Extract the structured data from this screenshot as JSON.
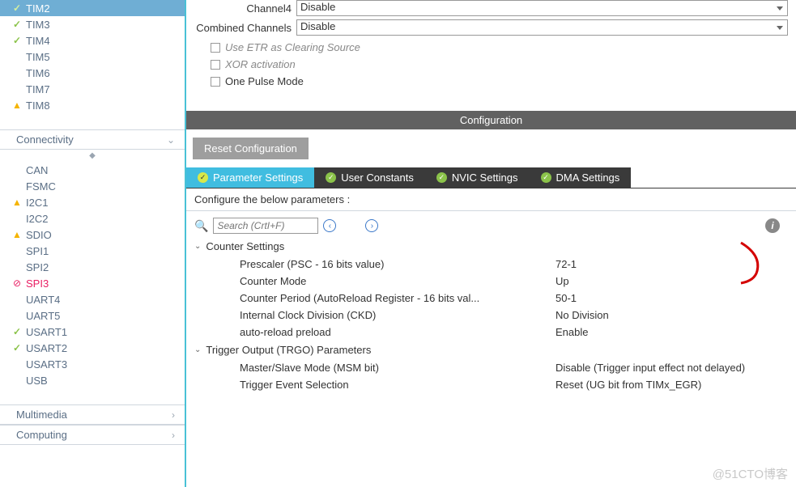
{
  "sidebar": {
    "timers": [
      {
        "label": "TIM2",
        "mark": "check",
        "selected": true
      },
      {
        "label": "TIM3",
        "mark": "check"
      },
      {
        "label": "TIM4",
        "mark": "check"
      },
      {
        "label": "TIM5",
        "mark": ""
      },
      {
        "label": "TIM6",
        "mark": ""
      },
      {
        "label": "TIM7",
        "mark": ""
      },
      {
        "label": "TIM8",
        "mark": "warn"
      }
    ],
    "sections": {
      "connectivity_label": "Connectivity",
      "multimedia_label": "Multimedia",
      "computing_label": "Computing"
    },
    "connectivity": [
      {
        "label": "CAN",
        "mark": ""
      },
      {
        "label": "FSMC",
        "mark": ""
      },
      {
        "label": "I2C1",
        "mark": "warn"
      },
      {
        "label": "I2C2",
        "mark": ""
      },
      {
        "label": "SDIO",
        "mark": "warn"
      },
      {
        "label": "SPI1",
        "mark": ""
      },
      {
        "label": "SPI2",
        "mark": ""
      },
      {
        "label": "SPI3",
        "mark": "deny"
      },
      {
        "label": "UART4",
        "mark": ""
      },
      {
        "label": "UART5",
        "mark": ""
      },
      {
        "label": "USART1",
        "mark": "check"
      },
      {
        "label": "USART2",
        "mark": "check"
      },
      {
        "label": "USART3",
        "mark": ""
      },
      {
        "label": "USB",
        "mark": ""
      }
    ]
  },
  "top_form": {
    "channel4_label": "Channel4",
    "channel4_value": "Disable",
    "combined_label": "Combined Channels",
    "combined_value": "Disable",
    "etr_label": "Use ETR as Clearing Source",
    "xor_label": "XOR activation",
    "onepulse_label": "One Pulse Mode"
  },
  "config": {
    "bar_label": "Configuration",
    "reset_label": "Reset Configuration"
  },
  "tabs": {
    "param": "Parameter Settings",
    "user": "User Constants",
    "nvic": "NVIC Settings",
    "dma": "DMA Settings"
  },
  "sub_label": "Configure the below parameters :",
  "search": {
    "placeholder": "Search (CrtI+F)"
  },
  "groups": {
    "counter": {
      "title": "Counter Settings",
      "rows": [
        {
          "name": "Prescaler (PSC - 16 bits value)",
          "val": "72-1"
        },
        {
          "name": "Counter Mode",
          "val": "Up"
        },
        {
          "name": "Counter Period (AutoReload Register - 16 bits val...",
          "val": "50-1"
        },
        {
          "name": "Internal Clock Division (CKD)",
          "val": "No Division"
        },
        {
          "name": "auto-reload preload",
          "val": "Enable"
        }
      ]
    },
    "trigger": {
      "title": "Trigger Output (TRGO) Parameters",
      "rows": [
        {
          "name": "Master/Slave Mode (MSM bit)",
          "val": "Disable (Trigger input effect not delayed)"
        },
        {
          "name": "Trigger Event Selection",
          "val": "Reset (UG bit from TIMx_EGR)"
        }
      ]
    }
  },
  "watermark": "@51CTO博客"
}
